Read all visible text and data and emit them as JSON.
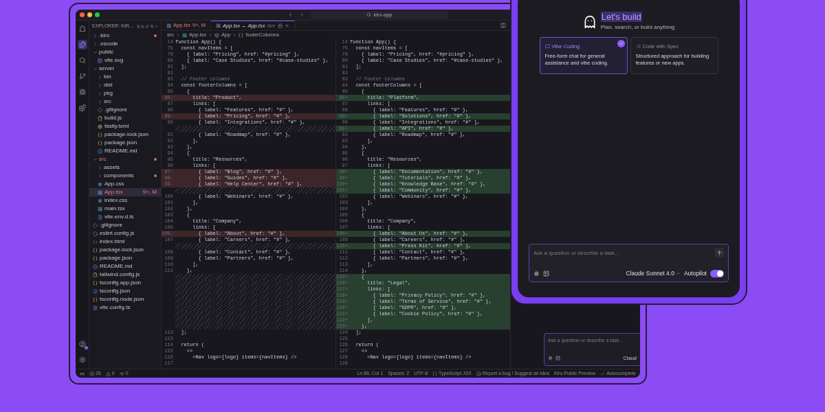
{
  "window": {
    "search": "kiro-app"
  },
  "activity_bar": [
    {
      "kind": "ghost",
      "selected": false
    },
    {
      "kind": "files",
      "selected": true
    },
    {
      "kind": "search",
      "selected": false
    },
    {
      "kind": "branch",
      "selected": false
    },
    {
      "kind": "debug",
      "selected": false
    },
    {
      "kind": "extensions",
      "selected": false
    },
    {
      "kind": "account",
      "selected": false
    },
    {
      "kind": "settings",
      "selected": false
    }
  ],
  "explorer": {
    "title": "EXPLORER: KIR…",
    "tree": [
      {
        "label": ".kiro",
        "kind": "folder",
        "expanded": false,
        "selected": false,
        "modified": true,
        "error": false
      },
      {
        "label": ".vscode",
        "kind": "folder",
        "expanded": false,
        "selected": false,
        "modified": false,
        "error": false
      },
      {
        "label": "public",
        "kind": "folder",
        "expanded": true,
        "selected": false,
        "modified": false,
        "error": false,
        "children": [
          {
            "label": "vite.svg",
            "kind": "svg",
            "selected": false,
            "modified": false,
            "error": false
          }
        ]
      },
      {
        "label": "server",
        "kind": "folder",
        "expanded": true,
        "selected": false,
        "modified": false,
        "error": false,
        "children": [
          {
            "label": "bin",
            "kind": "folder",
            "expanded": false,
            "selected": false,
            "modified": false,
            "error": false
          },
          {
            "label": "dist",
            "kind": "folder",
            "expanded": false,
            "selected": false,
            "modified": false,
            "error": false
          },
          {
            "label": "pkg",
            "kind": "folder",
            "expanded": false,
            "selected": false,
            "modified": false,
            "error": false
          },
          {
            "label": "src",
            "kind": "folder",
            "expanded": false,
            "selected": false,
            "modified": false,
            "error": false
          },
          {
            "label": ".gitignore",
            "kind": "gitignore",
            "selected": false,
            "modified": false,
            "error": false
          },
          {
            "label": "build.js",
            "kind": "js",
            "selected": false,
            "modified": false,
            "error": false
          },
          {
            "label": "fastly.toml",
            "kind": "toml",
            "selected": false,
            "modified": false,
            "error": false
          },
          {
            "label": "package-lock.json",
            "kind": "json",
            "selected": false,
            "modified": false,
            "error": false
          },
          {
            "label": "package.json",
            "kind": "json",
            "selected": false,
            "modified": false,
            "error": false
          },
          {
            "label": "README.md",
            "kind": "md",
            "selected": false,
            "modified": false,
            "error": false
          }
        ]
      },
      {
        "label": "src",
        "kind": "folder",
        "expanded": true,
        "selected": false,
        "modified": true,
        "error": true,
        "children": [
          {
            "label": "assets",
            "kind": "folder",
            "expanded": false,
            "selected": false,
            "modified": false,
            "error": false
          },
          {
            "label": "components",
            "kind": "folder",
            "expanded": false,
            "selected": false,
            "modified": true,
            "error": false
          },
          {
            "label": "App.css",
            "kind": "css",
            "selected": false,
            "modified": false,
            "error": false
          },
          {
            "label": "App.tsx",
            "kind": "tsx",
            "selected": true,
            "modified": false,
            "error": true,
            "badge": "9+, M"
          },
          {
            "label": "index.css",
            "kind": "css",
            "selected": false,
            "modified": false,
            "error": false
          },
          {
            "label": "main.tsx",
            "kind": "tsx",
            "selected": false,
            "modified": false,
            "error": false
          },
          {
            "label": "vite-env.d.ts",
            "kind": "ts",
            "selected": false,
            "modified": false,
            "error": false
          }
        ]
      },
      {
        "label": ".gitignore",
        "kind": "gitignore",
        "selected": false,
        "modified": false,
        "error": false
      },
      {
        "label": "eslint.config.js",
        "kind": "eslint",
        "selected": false,
        "modified": false,
        "error": false
      },
      {
        "label": "index.html",
        "kind": "html",
        "selected": false,
        "modified": false,
        "error": false
      },
      {
        "label": "package-lock.json",
        "kind": "json",
        "selected": false,
        "modified": false,
        "error": false
      },
      {
        "label": "package.json",
        "kind": "json",
        "selected": false,
        "modified": false,
        "error": false
      },
      {
        "label": "README.md",
        "kind": "md",
        "selected": false,
        "modified": false,
        "error": false
      },
      {
        "label": "tailwind.config.js",
        "kind": "js",
        "selected": false,
        "modified": false,
        "error": false
      },
      {
        "label": "tsconfig.app.json",
        "kind": "json",
        "selected": false,
        "modified": false,
        "error": false
      },
      {
        "label": "tsconfig.json",
        "kind": "tsconfig",
        "selected": false,
        "modified": false,
        "error": false
      },
      {
        "label": "tsconfig.node.json",
        "kind": "json",
        "selected": false,
        "modified": false,
        "error": false
      },
      {
        "label": "vite.config.ts",
        "kind": "ts",
        "selected": false,
        "modified": false,
        "error": false
      }
    ]
  },
  "tabs": [
    {
      "label": "App.tsx",
      "badge": "9+, M",
      "selected": false,
      "error": true
    },
    {
      "label": "App.tsx ↔ App.tsx",
      "detail": "/src",
      "selected": true,
      "error": false
    }
  ],
  "breadcrumb": [
    {
      "label": "src",
      "kind": "folder"
    },
    {
      "label": "App.tsx",
      "kind": "tsx"
    },
    {
      "label": "App",
      "kind": "function"
    },
    {
      "label": "footerColumns",
      "kind": "array"
    }
  ],
  "diff_left": [
    {
      "num": "14",
      "text": "function App() {",
      "kind": "normal"
    },
    {
      "num": "75",
      "text": "  const navItems = [",
      "kind": "normal"
    },
    {
      "num": "79",
      "text": "    { label: \"Pricing\", href: \"#pricing\" },",
      "kind": "normal"
    },
    {
      "num": "80",
      "text": "    { label: \"Case Studies\", href: \"#case-studies\" },",
      "kind": "normal"
    },
    {
      "num": "81",
      "text": "  ];",
      "kind": "normal"
    },
    {
      "num": "82",
      "kind": "normal"
    },
    {
      "num": "83",
      "text": "  // Footer columns",
      "kind": "comment"
    },
    {
      "num": "84",
      "text": "  const footerColumns = [",
      "kind": "normal"
    },
    {
      "num": "85",
      "text": "    {",
      "kind": "normal"
    },
    {
      "num": "86-",
      "text": "      title: \"Product\",",
      "kind": "removed"
    },
    {
      "num": "87",
      "text": "      links: [",
      "kind": "normal"
    },
    {
      "num": "88",
      "text": "        { label: \"Features\", href: \"#\" },",
      "kind": "normal"
    },
    {
      "num": "89-",
      "text": "        { label: \"Pricing\", href: \"#\" },",
      "kind": "removed"
    },
    {
      "num": "90",
      "text": "        { label: \"Integrations\", href: \"#\" },",
      "kind": "normal"
    },
    {
      "kind": "filler"
    },
    {
      "num": "91",
      "text": "        { label: \"Roadmap\", href: \"#\" },",
      "kind": "normal"
    },
    {
      "num": "92",
      "text": "      ],",
      "kind": "normal"
    },
    {
      "num": "93",
      "text": "    },",
      "kind": "normal"
    },
    {
      "num": "94",
      "text": "    {",
      "kind": "normal"
    },
    {
      "num": "95",
      "text": "      title: \"Resources\",",
      "kind": "normal"
    },
    {
      "num": "96",
      "text": "      links: [",
      "kind": "normal"
    },
    {
      "num": "97-",
      "text": "        { label: \"Blog\", href: \"#\" },",
      "kind": "removed"
    },
    {
      "num": "98-",
      "text": "        { label: \"Guides\", href: \"#\" },",
      "kind": "removed"
    },
    {
      "num": "99-",
      "text": "        { label: \"Help Center\", href: \"#\" },",
      "kind": "removed"
    },
    {
      "kind": "filler"
    },
    {
      "num": "100",
      "text": "        { label: \"Webinars\", href: \"#\" },",
      "kind": "normal"
    },
    {
      "num": "101",
      "text": "      ],",
      "kind": "normal"
    },
    {
      "num": "102",
      "text": "    },",
      "kind": "normal"
    },
    {
      "num": "103",
      "text": "    {",
      "kind": "normal"
    },
    {
      "num": "104",
      "text": "      title: \"Company\",",
      "kind": "normal"
    },
    {
      "num": "105",
      "text": "      links: [",
      "kind": "normal"
    },
    {
      "num": "106-",
      "text": "        { label: \"About\", href: \"#\" },",
      "kind": "removed"
    },
    {
      "num": "107",
      "text": "        { label: \"Careers\", href: \"#\" },",
      "kind": "normal"
    },
    {
      "kind": "filler"
    },
    {
      "num": "108",
      "text": "        { label: \"Contact\", href: \"#\" },",
      "kind": "normal"
    },
    {
      "num": "109",
      "text": "        { label: \"Partners\", href: \"#\" },",
      "kind": "normal"
    },
    {
      "num": "110",
      "text": "      ],",
      "kind": "normal"
    },
    {
      "num": "111",
      "text": "    },",
      "kind": "normal"
    },
    {
      "kind": "filler"
    },
    {
      "kind": "filler"
    },
    {
      "kind": "filler"
    },
    {
      "kind": "filler"
    },
    {
      "kind": "filler"
    },
    {
      "kind": "filler"
    },
    {
      "kind": "filler"
    },
    {
      "kind": "filler"
    },
    {
      "kind": "filler"
    },
    {
      "num": "112",
      "text": "  ];",
      "kind": "normal"
    },
    {
      "num": "113",
      "kind": "normal"
    },
    {
      "num": "114",
      "text": "  return (",
      "kind": "normal"
    },
    {
      "num": "115",
      "text": "    <>",
      "kind": "normal"
    },
    {
      "num": "116",
      "text": "      <Nav logo={logo} items={navItems} />",
      "kind": "normal"
    },
    {
      "num": "117",
      "kind": "normal"
    }
  ],
  "diff_right": [
    {
      "num": "14",
      "text": "function App() {",
      "kind": "normal"
    },
    {
      "num": "75",
      "text": "  const navItems = [",
      "kind": "normal"
    },
    {
      "num": "79",
      "text": "    { label: \"Pricing\", href: \"#pricing\" },",
      "kind": "normal"
    },
    {
      "num": "80",
      "text": "    { label: \"Case Studies\", href: \"#case-studies\" },",
      "kind": "normal"
    },
    {
      "num": "81",
      "text": "  ];",
      "kind": "normal"
    },
    {
      "num": "82",
      "kind": "normal"
    },
    {
      "num": "83",
      "text": "  // Footer columns",
      "kind": "comment"
    },
    {
      "num": "84",
      "text": "  const footerColumns = [",
      "kind": "normal"
    },
    {
      "num": "85",
      "text": "    {",
      "kind": "normal"
    },
    {
      "num": "86+",
      "text": "      title: \"Platform\",",
      "kind": "added"
    },
    {
      "num": "87",
      "text": "      links: [",
      "kind": "normal"
    },
    {
      "num": "88",
      "text": "        { label: \"Features\", href: \"#\" },",
      "kind": "normal"
    },
    {
      "num": "89+",
      "text": "        { label: \"Solutions\", href: \"#\" },",
      "kind": "added"
    },
    {
      "num": "90",
      "text": "        { label: \"Integrations\", href: \"#\" },",
      "kind": "normal"
    },
    {
      "num": "91+",
      "text": "        { label: \"API\", href: \"#\" },",
      "kind": "added"
    },
    {
      "num": "92",
      "text": "        { label: \"Roadmap\", href: \"#\" },",
      "kind": "normal"
    },
    {
      "num": "93",
      "text": "      ],",
      "kind": "normal"
    },
    {
      "num": "94",
      "text": "    },",
      "kind": "normal"
    },
    {
      "num": "95",
      "text": "    {",
      "kind": "normal"
    },
    {
      "num": "96",
      "text": "      title: \"Resources\",",
      "kind": "normal"
    },
    {
      "num": "97",
      "text": "      links: [",
      "kind": "normal"
    },
    {
      "num": "98+",
      "text": "        { label: \"Documentation\", href: \"#\" },",
      "kind": "added"
    },
    {
      "num": "99+",
      "text": "        { label: \"Tutorials\", href: \"#\" },",
      "kind": "added"
    },
    {
      "num": "100+",
      "text": "        { label: \"Knowledge Base\", href: \"#\" },",
      "kind": "added"
    },
    {
      "num": "101+",
      "text": "        { label: \"Community\", href: \"#\" },",
      "kind": "added"
    },
    {
      "num": "102",
      "text": "        { label: \"Webinars\", href: \"#\" },",
      "kind": "normal"
    },
    {
      "num": "103",
      "text": "      ],",
      "kind": "normal"
    },
    {
      "num": "104",
      "text": "    },",
      "kind": "normal"
    },
    {
      "num": "105",
      "text": "    {",
      "kind": "normal"
    },
    {
      "num": "106",
      "text": "      title: \"Company\",",
      "kind": "normal"
    },
    {
      "num": "107",
      "text": "      links: [",
      "kind": "normal"
    },
    {
      "num": "108+",
      "text": "        { label: \"About Us\", href: \"#\" },",
      "kind": "added"
    },
    {
      "num": "109",
      "text": "        { label: \"Careers\", href: \"#\" },",
      "kind": "normal"
    },
    {
      "num": "110+",
      "text": "        { label: \"Press Kit\", href: \"#\" },",
      "kind": "added"
    },
    {
      "num": "111",
      "text": "        { label: \"Contact\", href: \"#\" },",
      "kind": "normal"
    },
    {
      "num": "112",
      "text": "        { label: \"Partners\", href: \"#\" },",
      "kind": "normal"
    },
    {
      "num": "113",
      "text": "      ],",
      "kind": "normal"
    },
    {
      "num": "114",
      "text": "    },",
      "kind": "normal"
    },
    {
      "num": "115+",
      "text": "    {",
      "kind": "added"
    },
    {
      "num": "116+",
      "text": "      title: \"Legal\",",
      "kind": "added"
    },
    {
      "num": "117+",
      "text": "      links: [",
      "kind": "added"
    },
    {
      "num": "118+",
      "text": "        { label: \"Privacy Policy\", href: \"#\" },",
      "kind": "added"
    },
    {
      "num": "119+",
      "text": "        { label: \"Terms of Service\", href: \"#\" },",
      "kind": "added"
    },
    {
      "num": "120+",
      "text": "        { label: \"GDPR\", href: \"#\" },",
      "kind": "added"
    },
    {
      "num": "121+",
      "text": "        { label: \"Cookie Policy\", href: \"#\" },",
      "kind": "added"
    },
    {
      "num": "122+",
      "text": "      ],",
      "kind": "added"
    },
    {
      "num": "123+",
      "text": "    },",
      "kind": "added"
    },
    {
      "num": "124",
      "text": "  ];",
      "kind": "normal"
    },
    {
      "num": "125",
      "kind": "normal"
    },
    {
      "num": "126",
      "text": "  return (",
      "kind": "normal"
    },
    {
      "num": "127",
      "text": "    <>",
      "kind": "normal"
    },
    {
      "num": "128",
      "text": "      <Nav logo={logo} items={navItems} />",
      "kind": "normal"
    },
    {
      "num": "129",
      "kind": "normal"
    }
  ],
  "background_chat": {
    "placeholder": "Ask a question or describe a task...",
    "model": "Claud"
  },
  "status_bar": {
    "left": [
      {
        "kind": "remote"
      },
      {
        "kind": "errors",
        "text": "26"
      },
      {
        "kind": "warnings",
        "text": "0"
      },
      {
        "kind": "ports",
        "text": "0"
      }
    ],
    "right": [
      {
        "kind": "plain",
        "text": "Ln 86, Col 1"
      },
      {
        "kind": "plain",
        "text": "Spaces: 2"
      },
      {
        "kind": "plain",
        "text": "UTF-8"
      },
      {
        "kind": "language",
        "text": "TypeScript JSX"
      },
      {
        "kind": "feedback",
        "text": "Report a bug / Suggest an idea"
      },
      {
        "kind": "plain",
        "text": "Kiro Public Preview"
      },
      {
        "kind": "check",
        "text": "Autocomplete"
      }
    ]
  },
  "chat": {
    "title": "Let's build",
    "subtitle": "Plan, search, or build anything",
    "modes": [
      {
        "kind": "chat",
        "title": "Vibe Coding",
        "description": "Free-form chat for general assistance and vibe coding.",
        "selected": true
      },
      {
        "kind": "spec",
        "title": "Code with Spec",
        "description": "Structured approach for building features or new apps.",
        "selected": false
      }
    ],
    "input": {
      "placeholder": "Ask a question or describe a task..."
    },
    "model": "Claude Sonnet 4.0",
    "autopilot": {
      "label": "Autopilot",
      "on": true
    }
  }
}
